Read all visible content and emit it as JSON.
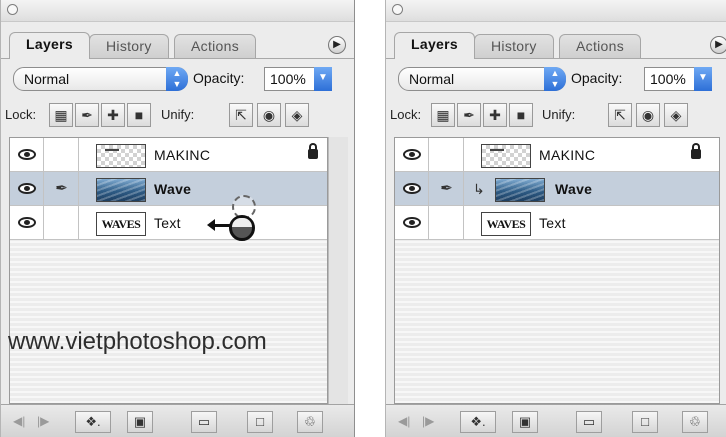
{
  "left_panel": {
    "tabs": [
      "Layers",
      "History",
      "Actions"
    ],
    "blend_mode": "Normal",
    "opacity_label": "Opacity:",
    "opacity_value": "100%",
    "lock_label": "Lock:",
    "unify_label": "Unify:",
    "layers": [
      {
        "name": "MAKINC",
        "thumb": "checker",
        "locked": true,
        "selected": false
      },
      {
        "name": "Wave",
        "thumb": "water",
        "locked": false,
        "selected": true
      },
      {
        "name": "Text",
        "thumb": "text",
        "thumb_text": "WAVES",
        "locked": false,
        "selected": false
      }
    ]
  },
  "right_panel": {
    "tabs": [
      "Layers",
      "History",
      "Actions"
    ],
    "blend_mode": "Normal",
    "opacity_label": "Opacity:",
    "opacity_value": "100%",
    "lock_label": "Lock:",
    "unify_label": "Unify:",
    "layers": [
      {
        "name": "MAKINC",
        "thumb": "checker",
        "locked": true,
        "selected": false
      },
      {
        "name": "Wave",
        "thumb": "water",
        "locked": false,
        "selected": true,
        "clipped": true
      },
      {
        "name": "Text",
        "thumb": "text",
        "thumb_text": "WAVES",
        "locked": false,
        "selected": false
      }
    ]
  },
  "watermark": "www.vietphotoshop.com",
  "icons": {
    "menu": "circle-arrow",
    "eye": "eye-visibility",
    "brush": "brush-link",
    "lock": "padlock",
    "move": "move-cross",
    "clip": "clipping-arrow",
    "trash": "trash-can"
  },
  "colors": {
    "panel_bg": "#ececec",
    "selected_row": "#c4cfdc",
    "accent_blue": "#2d6fd7"
  }
}
